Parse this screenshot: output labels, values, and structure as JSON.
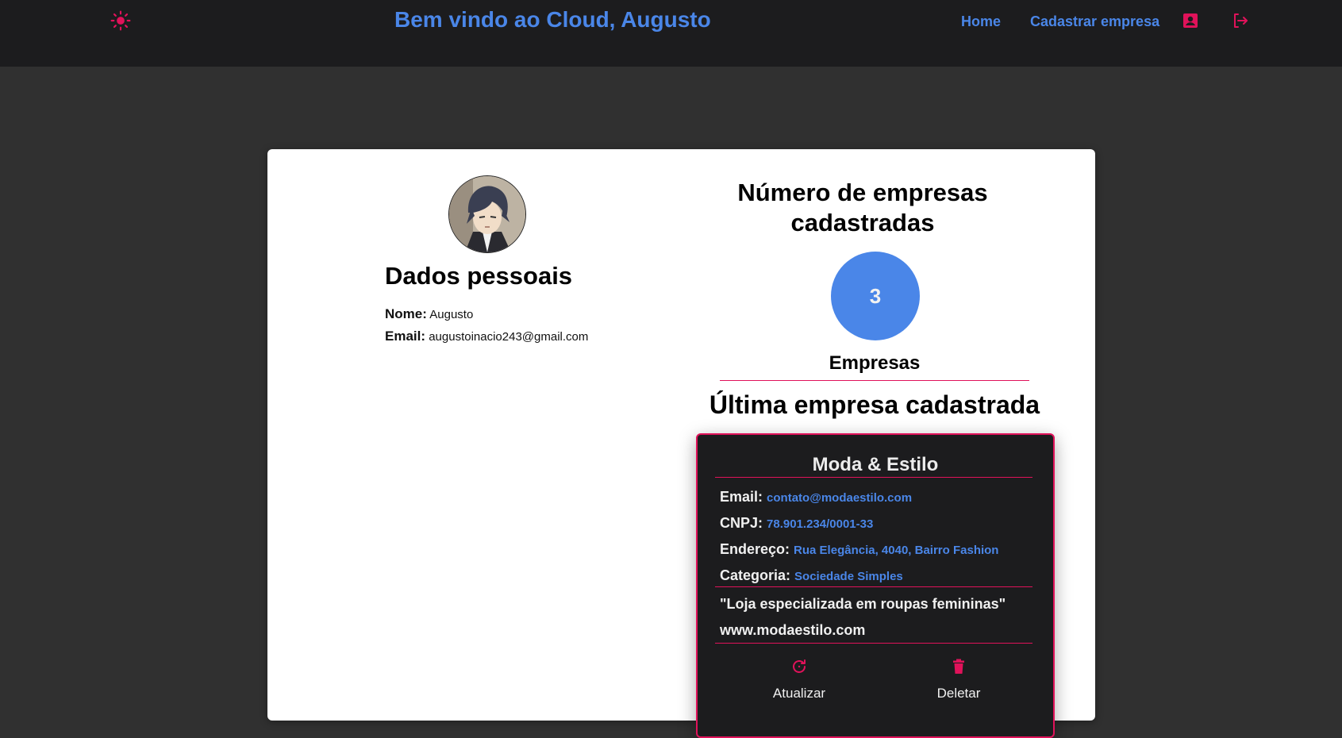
{
  "header": {
    "welcome": "Bem vindo ao Cloud, Augusto",
    "nav": {
      "home": "Home",
      "register_company": "Cadastrar empresa"
    },
    "icons": [
      "sun-icon",
      "account-box-icon",
      "logout-icon"
    ]
  },
  "profile": {
    "title": "Dados pessoais",
    "name_label": "Nome:",
    "name": "Augusto",
    "email_label": "Email:",
    "email": "augustoinacio243@gmail.com"
  },
  "stats": {
    "title": "Número de empresas cadastradas",
    "count": "3",
    "count_label": "Empresas"
  },
  "last_company": {
    "section_title": "Última empresa cadastrada",
    "name": "Moda & Estilo",
    "email_label": "Email:",
    "email": "contato@modaestilo.com",
    "cnpj_label": "CNPJ:",
    "cnpj": "78.901.234/0001-33",
    "address_label": "Endereço:",
    "address": "Rua Elegância, 4040, Bairro Fashion",
    "category_label": "Categoria:",
    "category": "Sociedade Simples",
    "description": "\"Loja especializada em roupas femininas\"",
    "website": "www.modaestilo.com",
    "actions": {
      "update": "Atualizar",
      "delete": "Deletar"
    }
  },
  "colors": {
    "accent_blue": "#4a86e8",
    "accent_pink": "#e0125a",
    "header_bg": "#1c1c1e",
    "page_bg": "#303030"
  }
}
